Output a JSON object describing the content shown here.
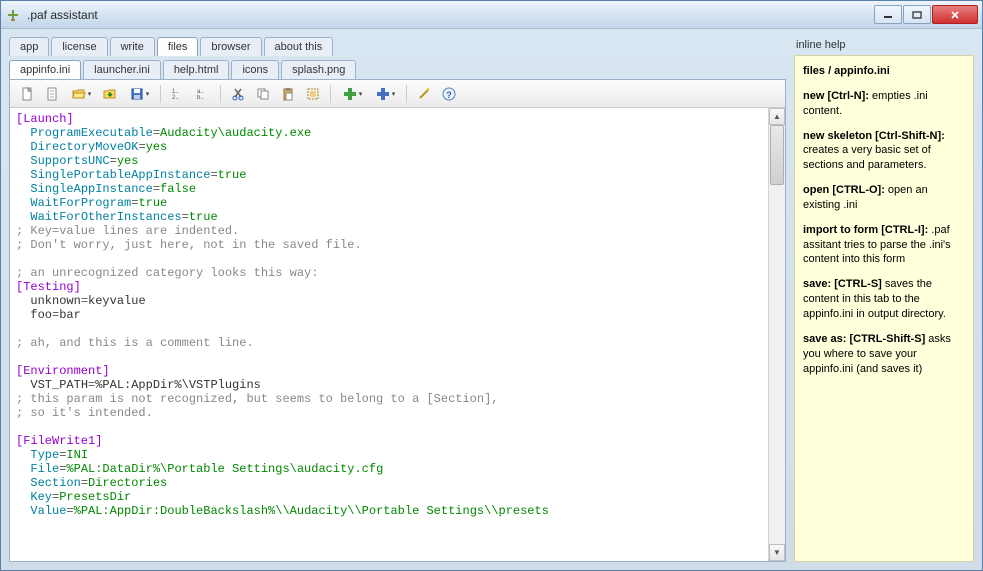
{
  "window": {
    "title": ".paf assistant"
  },
  "tabs_main": [
    {
      "label": "app",
      "active": false
    },
    {
      "label": "license",
      "active": false
    },
    {
      "label": "write",
      "active": false
    },
    {
      "label": "files",
      "active": true
    },
    {
      "label": "browser",
      "active": false
    },
    {
      "label": "about this",
      "active": false
    }
  ],
  "tabs_sub": [
    {
      "label": "appinfo.ini",
      "active": true
    },
    {
      "label": "launcher.ini",
      "active": false
    },
    {
      "label": "help.html",
      "active": false
    },
    {
      "label": "icons",
      "active": false
    },
    {
      "label": "splash.png",
      "active": false
    }
  ],
  "editor": {
    "lines": [
      {
        "t": "sec",
        "text": "[Launch]"
      },
      {
        "t": "kv",
        "indent": true,
        "key": "ProgramExecutable",
        "val": "Audacity\\audacity.exe"
      },
      {
        "t": "kv",
        "indent": true,
        "key": "DirectoryMoveOK",
        "val": "yes"
      },
      {
        "t": "kv",
        "indent": true,
        "key": "SupportsUNC",
        "val": "yes"
      },
      {
        "t": "kv",
        "indent": true,
        "key": "SinglePortableAppInstance",
        "val": "true"
      },
      {
        "t": "kv",
        "indent": true,
        "key": "SingleAppInstance",
        "val": "false"
      },
      {
        "t": "kv",
        "indent": true,
        "key": "WaitForProgram",
        "val": "true"
      },
      {
        "t": "kv",
        "indent": true,
        "key": "WaitForOtherInstances",
        "val": "true"
      },
      {
        "t": "cmt",
        "text": "; Key=value lines are indented."
      },
      {
        "t": "cmt",
        "text": "; Don't worry, just here, not in the saved file."
      },
      {
        "t": "blank"
      },
      {
        "t": "cmt",
        "text": "; an unrecognized category looks this way:"
      },
      {
        "t": "sec",
        "text": "[Testing]"
      },
      {
        "t": "kv2",
        "indent": true,
        "key": "unknown",
        "val": "keyvalue"
      },
      {
        "t": "kv2",
        "indent": true,
        "key": "foo",
        "val": "bar"
      },
      {
        "t": "blank"
      },
      {
        "t": "cmt",
        "text": "; ah, and this is a comment line."
      },
      {
        "t": "blank"
      },
      {
        "t": "sec",
        "text": "[Environment]"
      },
      {
        "t": "kv2",
        "indent": true,
        "key": "VST_PATH",
        "val": "%PAL:AppDir%\\VSTPlugins"
      },
      {
        "t": "cmt",
        "text": "; this param is not recognized, but seems to belong to a [Section],"
      },
      {
        "t": "cmt",
        "text": "; so it's intended."
      },
      {
        "t": "blank"
      },
      {
        "t": "sec",
        "text": "[FileWrite1]"
      },
      {
        "t": "kv",
        "indent": true,
        "key": "Type",
        "val": "INI"
      },
      {
        "t": "kv",
        "indent": true,
        "key": "File",
        "val": "%PAL:DataDir%\\Portable Settings\\audacity.cfg"
      },
      {
        "t": "kv",
        "indent": true,
        "key": "Section",
        "val": "Directories"
      },
      {
        "t": "kv",
        "indent": true,
        "key": "Key",
        "val": "PresetsDir"
      },
      {
        "t": "kv",
        "indent": true,
        "key": "Value",
        "val": "%PAL:AppDir:DoubleBackslash%\\\\Audacity\\\\Portable Settings\\\\presets"
      }
    ]
  },
  "help": {
    "panel_title": "inline help",
    "header": "files / appinfo.ini",
    "items": [
      {
        "key": "new [Ctrl-N]:",
        "desc": " empties .ini content."
      },
      {
        "key": "new skeleton [Ctrl-Shift-N]:",
        "desc": " creates a very basic set of sections and parameters."
      },
      {
        "key": "open [CTRL-O]:",
        "desc": " open an existing .ini"
      },
      {
        "key": "import to form [CTRL-I]:",
        "desc": " .paf assitant tries to parse the .ini's content into this form"
      },
      {
        "key": "save: [CTRL-S]",
        "desc": " saves the content in this tab to the appinfo.ini in output directory."
      },
      {
        "key": "save as: [CTRL-Shift-S]",
        "desc": " asks you where to save your appinfo.ini (and saves it)"
      }
    ]
  },
  "toolbar_icons": [
    "new-file-icon",
    "new-skeleton-icon",
    "open-icon",
    "import-icon",
    "save-icon",
    "sep",
    "indent-icon",
    "outdent-icon",
    "sep",
    "cut-icon",
    "copy-icon",
    "paste-icon",
    "select-all-icon",
    "sep",
    "add-green-icon",
    "add-blue-icon",
    "sep",
    "wand-icon",
    "help-icon"
  ]
}
